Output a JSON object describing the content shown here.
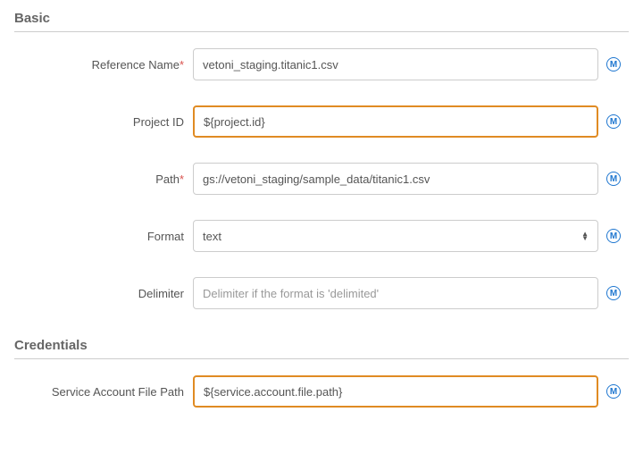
{
  "sections": {
    "basic": {
      "title": "Basic",
      "fields": {
        "referenceName": {
          "label": "Reference Name",
          "required": true,
          "value": "vetoni_staging.titanic1.csv",
          "highlight": false
        },
        "projectId": {
          "label": "Project ID",
          "required": false,
          "value": "${project.id}",
          "highlight": true
        },
        "path": {
          "label": "Path",
          "required": true,
          "value": "gs://vetoni_staging/sample_data/titanic1.csv",
          "highlight": false
        },
        "format": {
          "label": "Format",
          "required": false,
          "value": "text",
          "highlight": false
        },
        "delimiter": {
          "label": "Delimiter",
          "required": false,
          "value": "",
          "placeholder": "Delimiter if the format is 'delimited'",
          "highlight": false
        }
      }
    },
    "credentials": {
      "title": "Credentials",
      "fields": {
        "serviceAccountFilePath": {
          "label": "Service Account File Path",
          "required": false,
          "value": "${service.account.file.path}",
          "highlight": true
        }
      }
    }
  },
  "macroIconGlyph": "M"
}
